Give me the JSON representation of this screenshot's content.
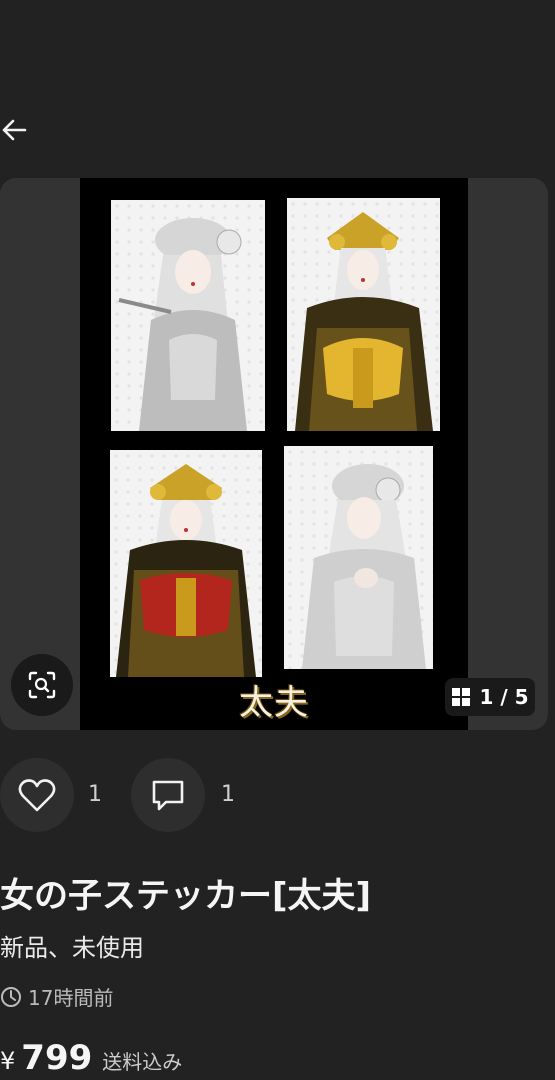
{
  "header": {
    "back_icon": "arrow-left-icon"
  },
  "carousel": {
    "caption": "太夫",
    "counter": "1 / 5",
    "zoom_icon": "zoom-scan-icon",
    "grid_icon": "grid-icon"
  },
  "actions": {
    "like_count": "1",
    "comment_count": "1"
  },
  "item": {
    "title": "女の子ステッカー[太夫]",
    "condition": "新品、未使用",
    "time": "17時間前",
    "currency": "¥",
    "price": "799",
    "shipping": "送料込み"
  },
  "colors": {
    "background": "#222222",
    "carousel_bg": "#333333",
    "gold": "#c9a227",
    "red": "#b3261e"
  }
}
